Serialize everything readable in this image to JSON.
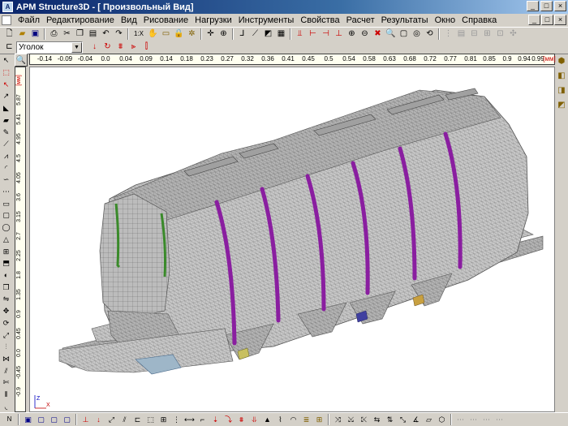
{
  "window": {
    "title": "APM Structure3D - [ Произвольный Вид]",
    "app_icon_letter": "A",
    "controls": [
      "_",
      "□",
      "×"
    ]
  },
  "menubar": {
    "items": [
      "Файл",
      "Редактирование",
      "Вид",
      "Рисование",
      "Нагрузки",
      "Инструменты",
      "Свойства",
      "Расчет",
      "Результаты",
      "Окно",
      "Справка"
    ],
    "doc_controls": [
      "_",
      "□",
      "×"
    ]
  },
  "toolbar_main": {
    "scale_label": "1:X",
    "icons": [
      "new-icon",
      "open-icon",
      "save-icon",
      "print-icon",
      "cut-icon",
      "copy-icon",
      "paste-icon",
      "undo-icon",
      "redo-icon"
    ]
  },
  "toolbar_secondary": {
    "profile_select": {
      "value": "Уголок"
    }
  },
  "ruler": {
    "horizontal_ticks": [
      "-0.14",
      "-0.09",
      "-0.04",
      "0.0",
      "0.04",
      "0.09",
      "0.14",
      "0.18",
      "0.23",
      "0.27",
      "0.32",
      "0.36",
      "0.41",
      "0.45",
      "0.5",
      "0.54",
      "0.58",
      "0.63",
      "0.68",
      "0.72",
      "0.77",
      "0.81",
      "0.85",
      "0.9",
      "0.94",
      "0.99"
    ],
    "horizontal_unit": "[мм]",
    "vertical_ticks": [
      "5.87",
      "5.41",
      "4.95",
      "4.5",
      "4.05",
      "3.6",
      "3.15",
      "2.7",
      "2.25",
      "1.8",
      "1.35",
      "0.9",
      "0.45",
      "0.0",
      "-0.45",
      "-0.9"
    ],
    "vertical_unit": "[мм]"
  },
  "viewport": {
    "view_name": "Произвольный Вид",
    "axis_x": "X",
    "axis_z": "Z",
    "model_color": "#9a9a9a",
    "rib_color": "#8a1ea0",
    "end_rib_color": "#3a8a2a"
  },
  "bottom_toolbar": {
    "left_label": "N"
  },
  "colors": {
    "chrome": "#d4d0c8",
    "title_active": "#0a246a",
    "ruler_bg": "#fffff0"
  }
}
